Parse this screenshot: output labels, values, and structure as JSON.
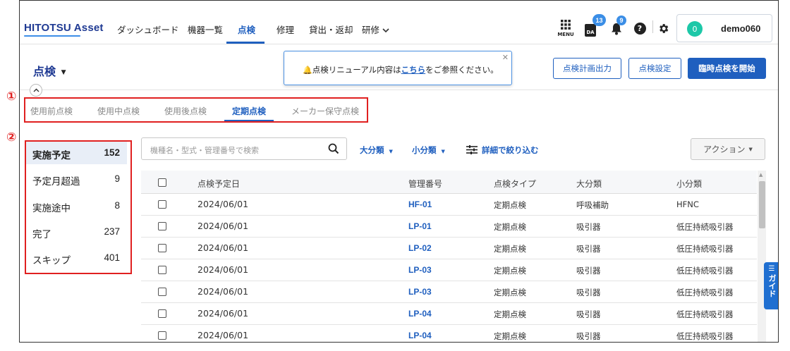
{
  "header": {
    "logo": "HITOTSU Asset",
    "nav": [
      {
        "label": "ダッシュボード"
      },
      {
        "label": "機器一覧"
      },
      {
        "label": "点検"
      },
      {
        "label": "修理"
      },
      {
        "label": "貸出・返却"
      },
      {
        "label": "研修"
      }
    ],
    "menu_label": "MENU",
    "da_badge": "13",
    "notif_badge": "9",
    "user_avatar": "0",
    "user_name": "demo060"
  },
  "page": {
    "title": "点検",
    "notice_pre": "点検リニューアル内容は",
    "notice_link": "こちら",
    "notice_post": "をご参照ください。",
    "buttons": {
      "export": "点検計画出力",
      "settings": "点検設定",
      "start": "臨時点検を開始"
    }
  },
  "tabs": [
    "使用前点検",
    "使用中点検",
    "使用後点検",
    "定期点検",
    "メーカー保守点検"
  ],
  "annotations": {
    "one": "①",
    "two": "②"
  },
  "sidebar": [
    {
      "label": "実施予定",
      "count": "152"
    },
    {
      "label": "予定月超過",
      "count": "9"
    },
    {
      "label": "実施途中",
      "count": "8"
    },
    {
      "label": "完了",
      "count": "237"
    },
    {
      "label": "スキップ",
      "count": "401"
    }
  ],
  "search": {
    "placeholder": "機種名・型式・管理番号で検索"
  },
  "filters": {
    "major": "大分類",
    "minor": "小分類",
    "detail": "詳細で絞り込む"
  },
  "action_label": "アクション",
  "table": {
    "headers": [
      "点検予定日",
      "管理番号",
      "点検タイプ",
      "大分類",
      "小分類"
    ],
    "rows": [
      [
        "2024/06/01",
        "HF-01",
        "定期点検",
        "呼吸補助",
        "HFNC"
      ],
      [
        "2024/06/01",
        "LP-01",
        "定期点検",
        "吸引器",
        "低圧持続吸引器"
      ],
      [
        "2024/06/01",
        "LP-02",
        "定期点検",
        "吸引器",
        "低圧持続吸引器"
      ],
      [
        "2024/06/01",
        "LP-03",
        "定期点検",
        "吸引器",
        "低圧持続吸引器"
      ],
      [
        "2024/06/01",
        "LP-03",
        "定期点検",
        "吸引器",
        "低圧持続吸引器"
      ],
      [
        "2024/06/01",
        "LP-04",
        "定期点検",
        "吸引器",
        "低圧持続吸引器"
      ],
      [
        "2024/06/01",
        "LP-04",
        "定期点検",
        "吸引器",
        "低圧持続吸引器"
      ]
    ]
  },
  "guide_label": "ガイド",
  "colors": {
    "brand": "#1f5fbf",
    "annotation": "#e02020",
    "avatar": "#1dc8a8"
  }
}
